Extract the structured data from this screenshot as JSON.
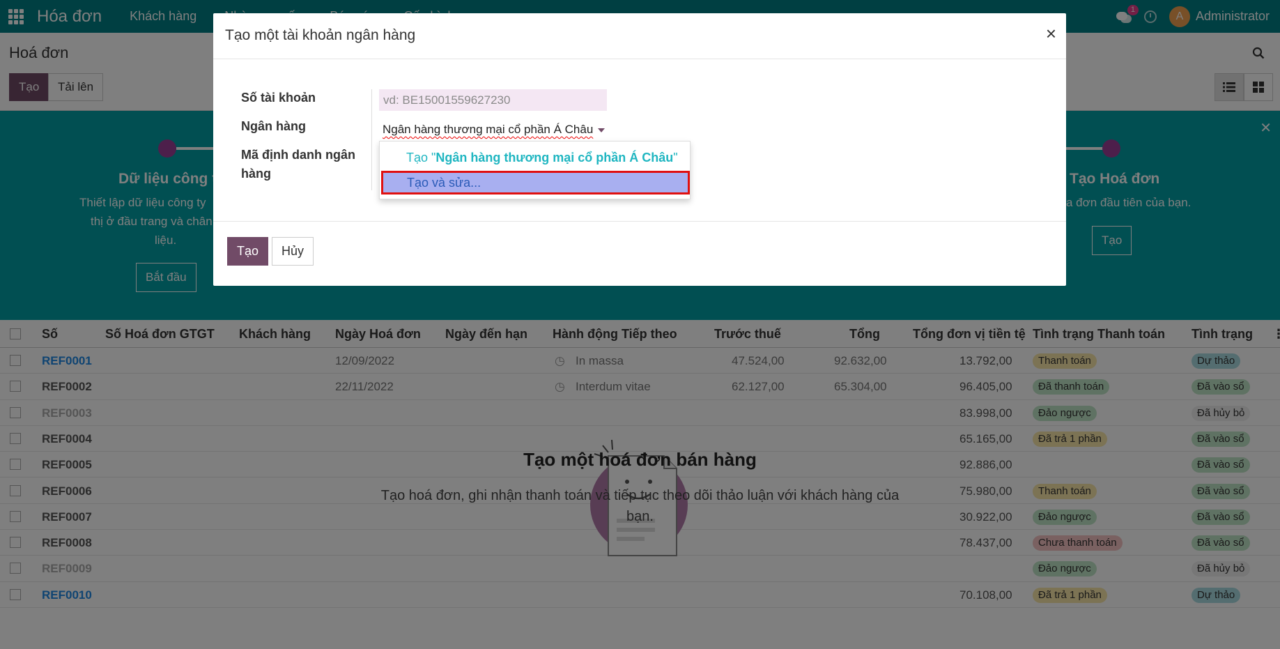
{
  "navbar": {
    "brand": "Hóa đơn",
    "menu": [
      "Khách hàng",
      "Nhà cung cấp",
      "Báo cáo",
      "Cấu hình"
    ],
    "chat_badge": "1",
    "avatar_letter": "A",
    "user": "Administrator"
  },
  "control": {
    "title": "Hoá đơn",
    "create_label": "Tạo",
    "upload_label": "Tải lên"
  },
  "onboarding": {
    "left_title": "Dữ liệu công ty",
    "left_text_1": "Thiết lập dữ liệu công ty",
    "left_text_2": "thị ở đầu trang và chân t",
    "left_text_3": "liệu.",
    "left_button": "Bắt đầu",
    "right_title": "Tạo Hoá đơn",
    "right_text": "a đơn đầu tiên của bạn.",
    "right_button": "Tạo"
  },
  "table": {
    "columns": [
      "Số",
      "Số Hoá đơn GTGT",
      "Khách hàng",
      "Ngày Hoá đơn",
      "Ngày đến hạn",
      "Hành động Tiếp theo",
      "Trước thuế",
      "Tổng",
      "Tổng đơn vị tiền tệ",
      "Tình trạng Thanh toán",
      "Tình trạng"
    ],
    "rows": [
      {
        "ref": "REF0001",
        "date": "12/09/2022",
        "action": "In massa",
        "untaxed": "47.524,00",
        "total": "92.632,00",
        "currency_total": "13.792,00",
        "payment": "Thanh toán",
        "state": "Dự thảo"
      },
      {
        "ref": "REF0002",
        "date": "22/11/2022",
        "action": "Interdum vitae",
        "untaxed": "62.127,00",
        "total": "65.304,00",
        "currency_total": "96.405,00",
        "payment": "Đã thanh toán",
        "state": "Đã vào sổ"
      },
      {
        "ref": "REF0003",
        "date": "",
        "action": "",
        "untaxed": "",
        "total": "",
        "currency_total": "83.998,00",
        "payment": "Đảo ngược",
        "state": "Đã hủy bỏ"
      },
      {
        "ref": "REF0004",
        "date": "",
        "action": "",
        "untaxed": "",
        "total": "",
        "currency_total": "65.165,00",
        "payment": "Đã trả 1 phần",
        "state": "Đã vào sổ"
      },
      {
        "ref": "REF0005",
        "date": "",
        "action": "",
        "untaxed": "",
        "total": "",
        "currency_total": "92.886,00",
        "payment": "",
        "state": "Đã vào sổ"
      },
      {
        "ref": "REF0006",
        "date": "",
        "action": "",
        "untaxed": "",
        "total": "",
        "currency_total": "75.980,00",
        "payment": "Thanh toán",
        "state": "Đã vào sổ"
      },
      {
        "ref": "REF0007",
        "date": "",
        "action": "",
        "untaxed": "",
        "total": "",
        "currency_total": "30.922,00",
        "payment": "Đảo ngược",
        "state": "Đã vào sổ"
      },
      {
        "ref": "REF0008",
        "date": "",
        "action": "",
        "untaxed": "",
        "total": "",
        "currency_total": "78.437,00",
        "payment": "Chưa thanh toán",
        "state": "Đã vào sổ"
      },
      {
        "ref": "REF0009",
        "date": "",
        "action": "",
        "untaxed": "",
        "total": "",
        "currency_total": "",
        "payment": "Đảo ngược",
        "state": "Đã hủy bỏ"
      },
      {
        "ref": "REF0010",
        "date": "",
        "action": "",
        "untaxed": "",
        "total": "",
        "currency_total": "70.108,00",
        "payment": "Đã trả 1 phần",
        "state": "Dự thảo"
      }
    ]
  },
  "empty_help": {
    "title": "Tạo một hoá đơn bán hàng",
    "text": "Tạo hoá đơn, ghi nhận thanh toán và tiếp tục theo dõi thảo luận với khách hàng của bạn."
  },
  "modal": {
    "title": "Tạo một tài khoản ngân hàng",
    "close_symbol": "×",
    "account_label": "Số tài khoản",
    "account_placeholder": "vd: BE15001559627230",
    "bank_label": "Ngân hàng",
    "bank_value": "Ngân hàng thương mại cổ phần Á Châu",
    "bank_id_label_1": "Mã định danh ngân",
    "bank_id_label_2": "hàng",
    "create_button": "Tạo",
    "cancel_button": "Hủy"
  },
  "dropdown": {
    "create_prefix": "Tạo \"",
    "create_name": "Ngân hàng thương mại cổ phần Á Châu",
    "create_suffix": "\"",
    "create_edit": "Tạo và sửa..."
  },
  "colors": {
    "navbar": "#017e84",
    "primary": "#714b67",
    "onboarding": "#029ea5",
    "highlight": "#a8aff0",
    "highlight_border": "#e01010"
  }
}
